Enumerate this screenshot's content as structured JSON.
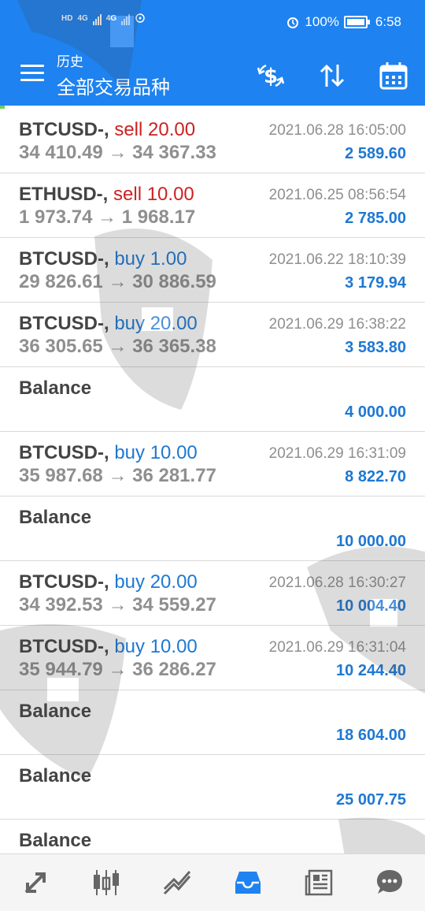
{
  "status_bar": {
    "battery": "100%",
    "time": "6:58",
    "network": [
      "HD",
      "4G",
      "4G"
    ]
  },
  "header": {
    "subtitle": "历史",
    "title": "全部交易品种"
  },
  "rows": [
    {
      "type": "trade",
      "symbol": "BTCUSD-,",
      "action": "sell",
      "volume": "20.00",
      "open_price": "34 410.49",
      "close_price": "34 367.33",
      "time": "2021.06.28 16:05:00",
      "profit": "2 589.60"
    },
    {
      "type": "trade",
      "symbol": "ETHUSD-,",
      "action": "sell",
      "volume": "10.00",
      "open_price": "1 973.74",
      "close_price": "1 968.17",
      "time": "2021.06.25 08:56:54",
      "profit": "2 785.00"
    },
    {
      "type": "trade",
      "symbol": "BTCUSD-,",
      "action": "buy",
      "volume": "1.00",
      "open_price": "29 826.61",
      "close_price": "30 886.59",
      "time": "2021.06.22 18:10:39",
      "profit": "3 179.94"
    },
    {
      "type": "trade",
      "symbol": "BTCUSD-,",
      "action": "buy",
      "volume": "20.00",
      "open_price": "36 305.65",
      "close_price": "36 365.38",
      "time": "2021.06.29 16:38:22",
      "profit": "3 583.80"
    },
    {
      "type": "balance",
      "label": "Balance",
      "profit": "4 000.00"
    },
    {
      "type": "trade",
      "symbol": "BTCUSD-,",
      "action": "buy",
      "volume": "10.00",
      "open_price": "35 987.68",
      "close_price": "36 281.77",
      "time": "2021.06.29 16:31:09",
      "profit": "8 822.70"
    },
    {
      "type": "balance",
      "label": "Balance",
      "profit": "10 000.00"
    },
    {
      "type": "trade",
      "symbol": "BTCUSD-,",
      "action": "buy",
      "volume": "20.00",
      "open_price": "34 392.53",
      "close_price": "34 559.27",
      "time": "2021.06.28 16:30:27",
      "profit": "10 004.40"
    },
    {
      "type": "trade",
      "symbol": "BTCUSD-,",
      "action": "buy",
      "volume": "10.00",
      "open_price": "35 944.79",
      "close_price": "36 286.27",
      "time": "2021.06.29 16:31:04",
      "profit": "10 244.40"
    },
    {
      "type": "balance",
      "label": "Balance",
      "profit": "18 604.00"
    },
    {
      "type": "balance",
      "label": "Balance",
      "profit": "25 007.75"
    },
    {
      "type": "balance",
      "label": "Balance",
      "profit": ""
    }
  ],
  "colors": {
    "header": "#1e82f0",
    "sell": "#cc2222",
    "buy": "#1e78d2",
    "profit": "#1e78d2",
    "nav_active": "#1e82f0",
    "nav_inactive": "#666666"
  },
  "bottom_nav": [
    {
      "icon": "quotes-arrows-icon",
      "active": false
    },
    {
      "icon": "candlestick-chart-icon",
      "active": false
    },
    {
      "icon": "trade-chart-icon",
      "active": false
    },
    {
      "icon": "history-inbox-icon",
      "active": true
    },
    {
      "icon": "news-icon",
      "active": false
    },
    {
      "icon": "chat-icon",
      "active": false
    }
  ]
}
